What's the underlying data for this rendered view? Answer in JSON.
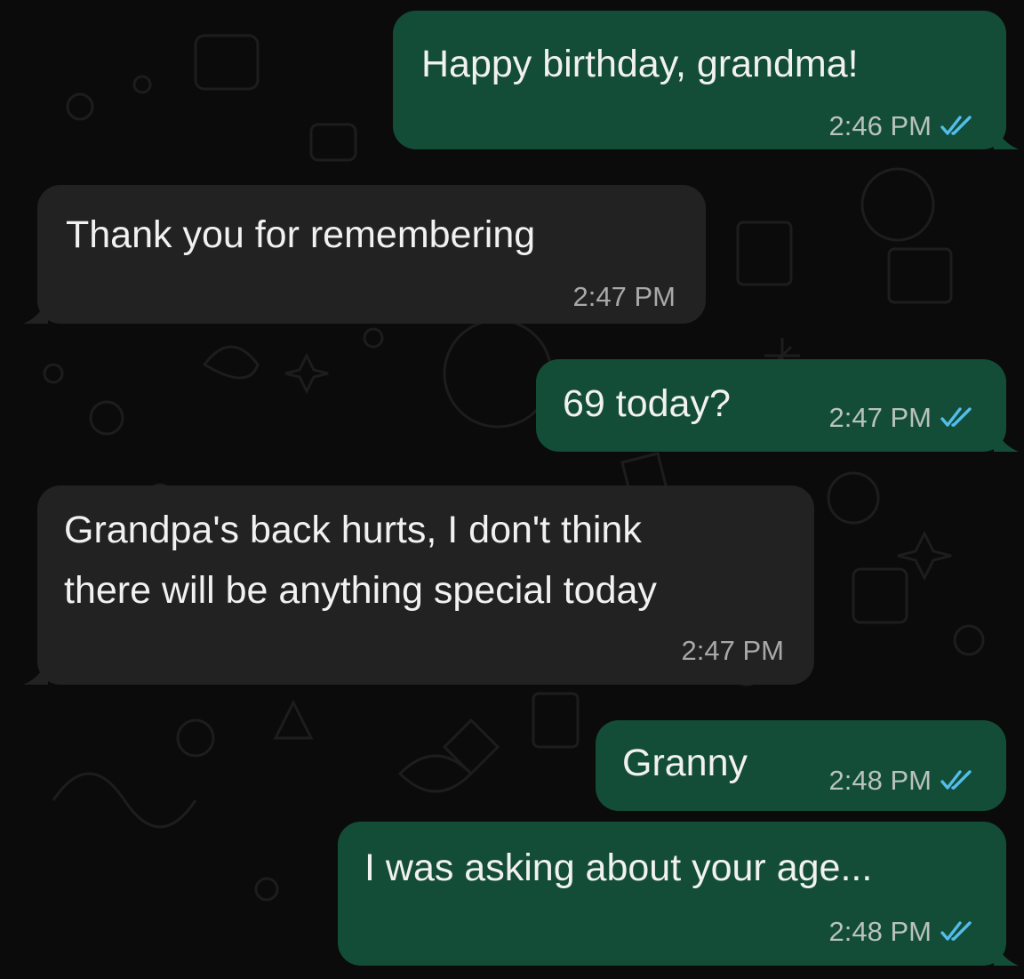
{
  "chat": {
    "messages": [
      {
        "direction": "outgoing",
        "text": "Happy birthday, grandma!",
        "time": "2:46 PM",
        "status": "read-ticks-icon"
      },
      {
        "direction": "incoming",
        "text": "Thank you for remembering",
        "time": "2:47 PM"
      },
      {
        "direction": "outgoing",
        "text": "69 today?",
        "time": "2:47 PM",
        "status": "read-ticks-icon"
      },
      {
        "direction": "incoming",
        "text_line1": "Grandpa's back hurts, I don't think",
        "text_line2": "there will be anything special today",
        "time": "2:47 PM"
      },
      {
        "direction": "outgoing",
        "text": "Granny",
        "time": "2:48 PM",
        "status": "read-ticks-icon"
      },
      {
        "direction": "outgoing",
        "text": "I was asking about your age...",
        "time": "2:48 PM",
        "status": "read-ticks-icon"
      }
    ]
  },
  "colors": {
    "background": "#0b0b0b",
    "outgoing_bubble": "#134d37",
    "incoming_bubble": "#222223",
    "read_ticks": "#53bdeb"
  }
}
